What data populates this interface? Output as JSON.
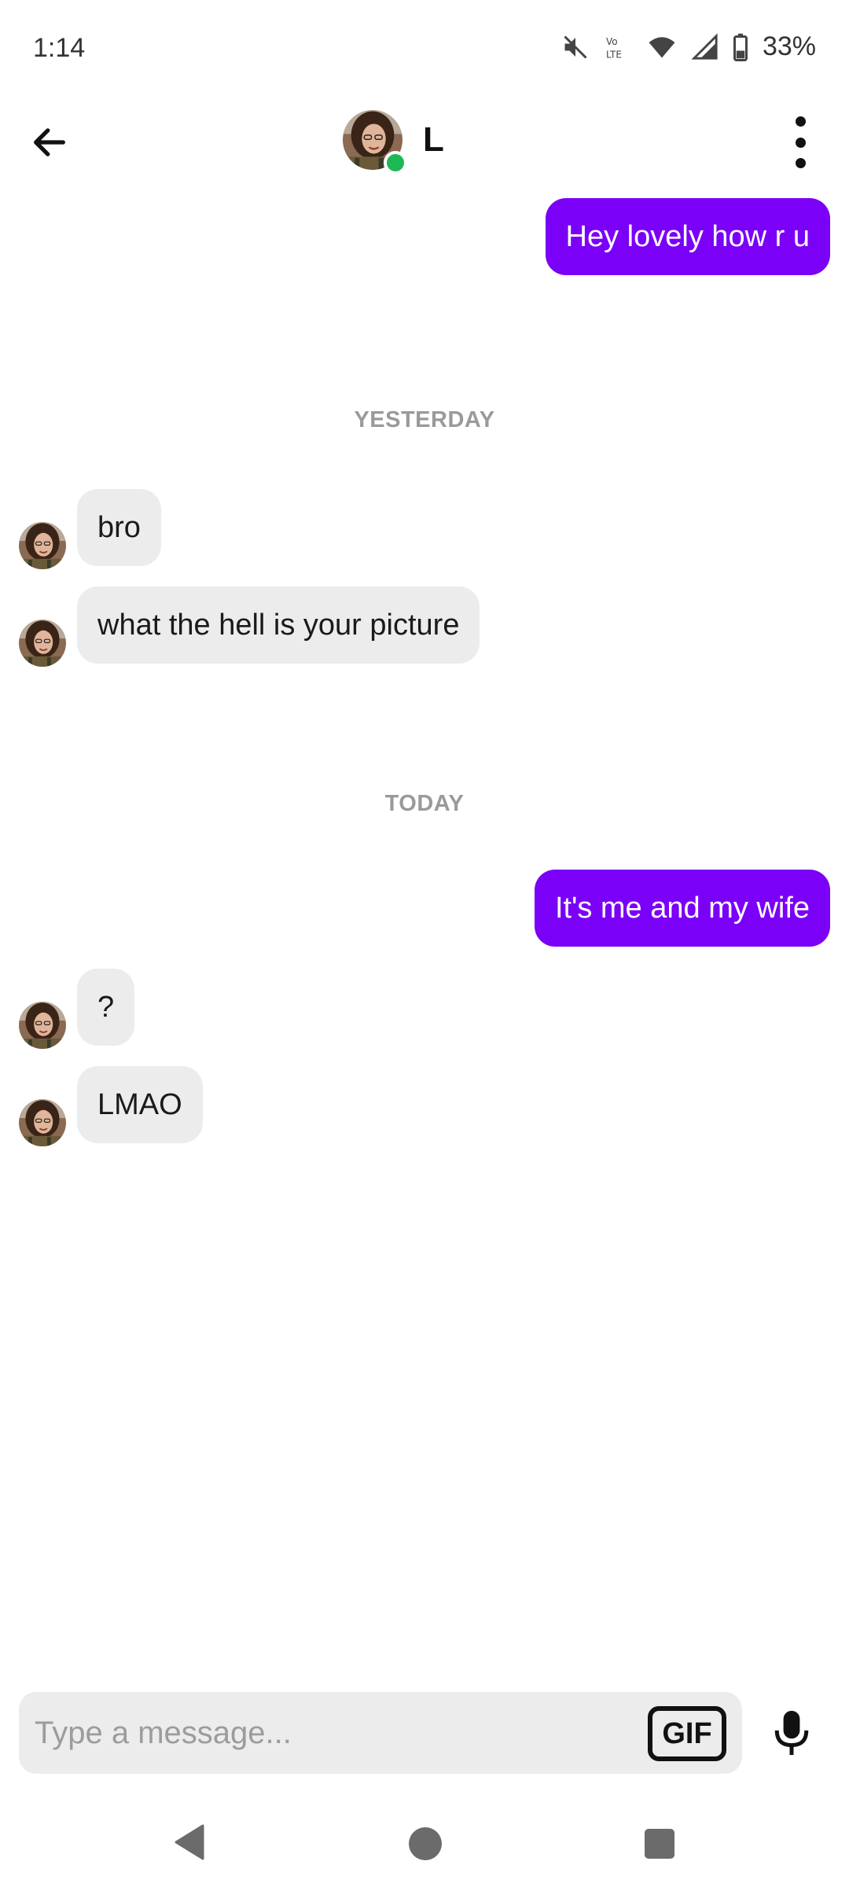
{
  "status_bar": {
    "time": "1:14",
    "battery": "33%",
    "icons": [
      "mute-icon",
      "volte-icon",
      "wifi-icon",
      "signal-icon",
      "battery-icon"
    ]
  },
  "header": {
    "contact_name": "L",
    "online_status_color": "#1db954",
    "icons": [
      "back-arrow-icon",
      "more-vertical-icon"
    ]
  },
  "messages": {
    "m1": "Hey lovely how r u",
    "yesterday_label": "YESTERDAY",
    "m2": "bro",
    "m3": "what the hell is your picture",
    "today_label": "TODAY",
    "m4": "It's me and my wife",
    "m5": "?",
    "m6": "LMAO"
  },
  "composer": {
    "placeholder": "Type a message...",
    "gif_label": "GIF",
    "icons": [
      "microphone-icon"
    ]
  },
  "colors": {
    "outgoing_bubble": "#7b00f7",
    "incoming_bubble": "#ececec",
    "day_label": "#9a9a9a"
  },
  "nav_bar": {
    "icons": [
      "nav-back-icon",
      "nav-home-icon",
      "nav-recents-icon"
    ]
  }
}
